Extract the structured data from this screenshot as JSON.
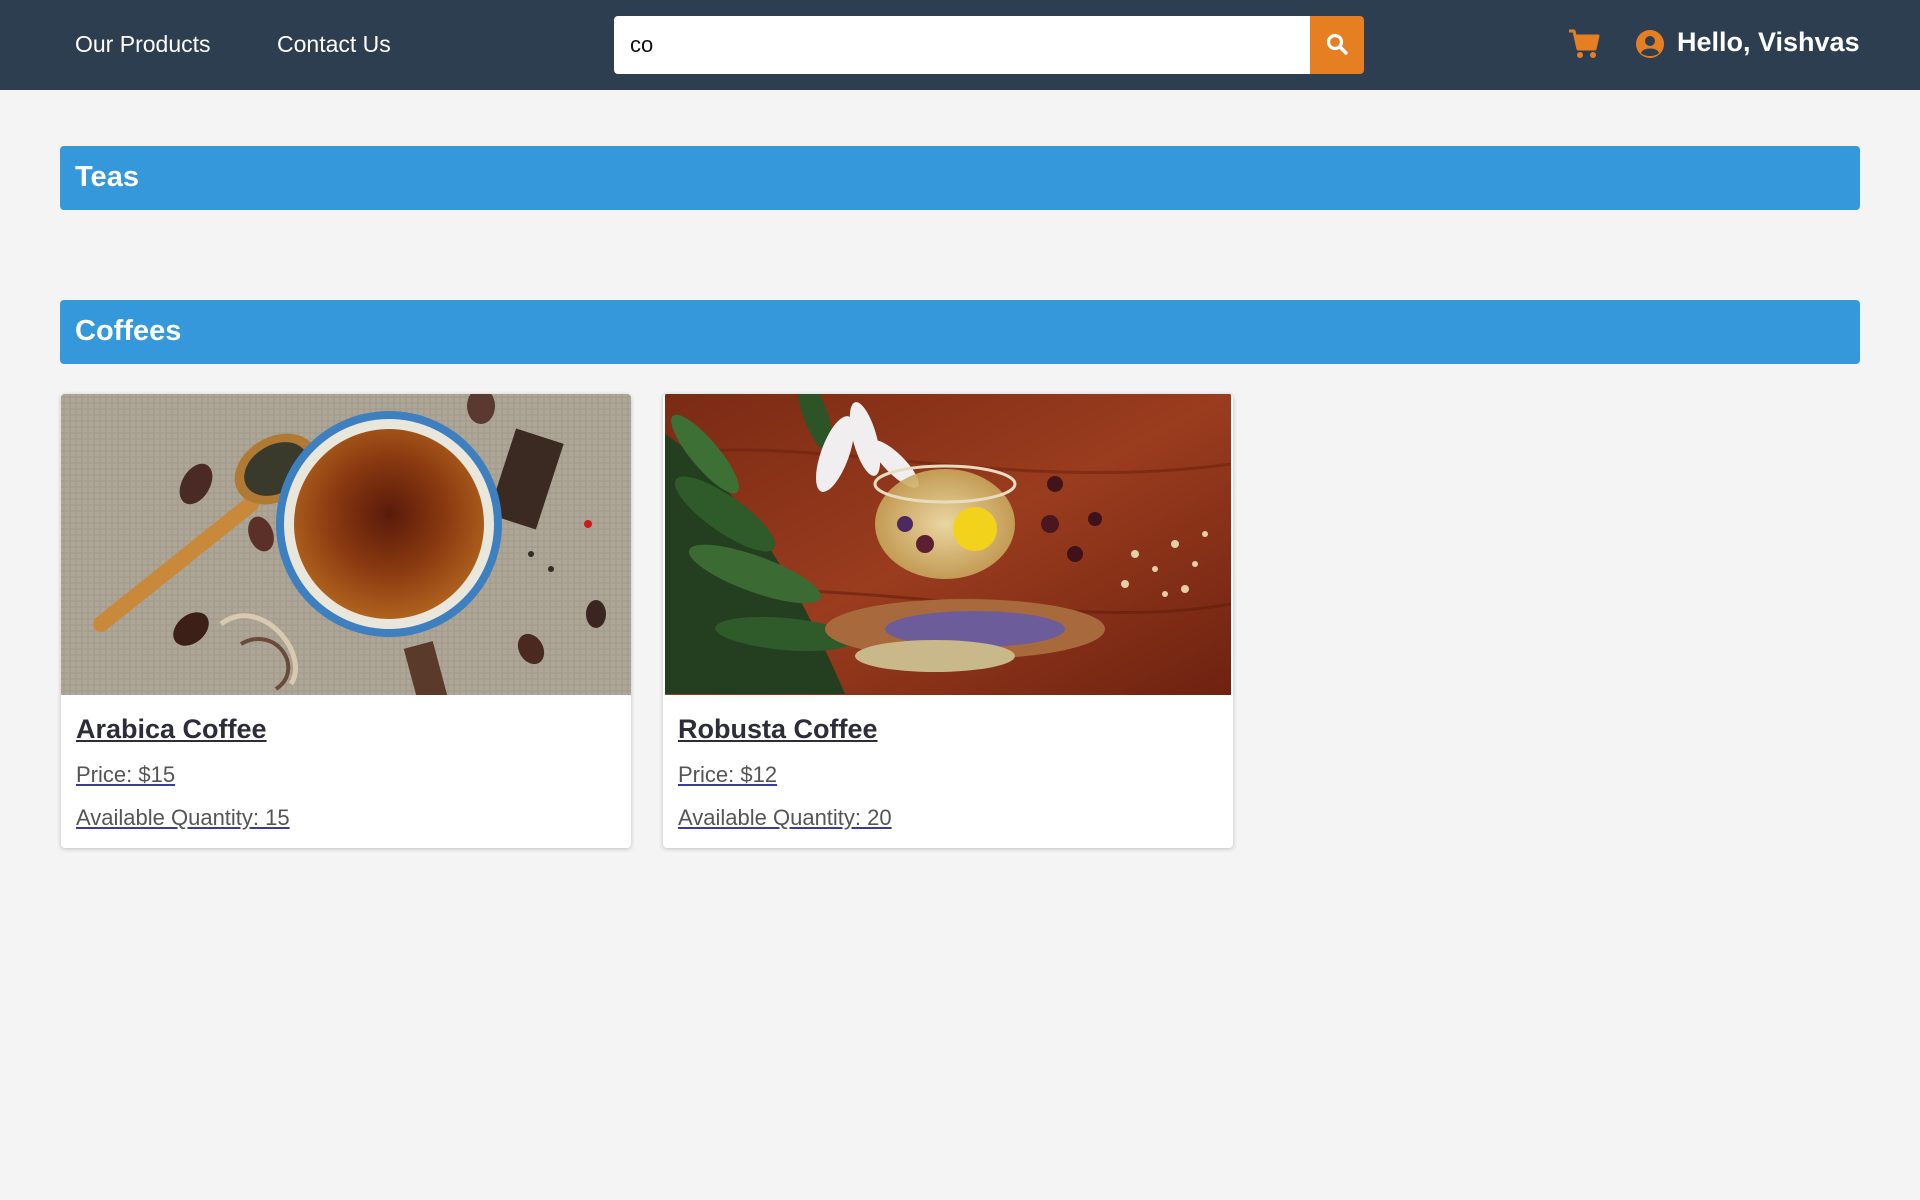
{
  "header": {
    "nav": [
      {
        "label": "Our Products"
      },
      {
        "label": "Contact Us"
      }
    ],
    "search": {
      "value": "co",
      "placeholder": ""
    },
    "greeting": "Hello, Vishvas"
  },
  "icons": {
    "search": "search-icon",
    "cart": "cart-icon",
    "user": "user-circle-icon"
  },
  "colors": {
    "header_bg": "#2c3e50",
    "accent": "#e67e22",
    "section_bar": "#3498db",
    "page_bg": "#f4f4f4"
  },
  "sections": [
    {
      "title": "Teas",
      "products": []
    },
    {
      "title": "Coffees",
      "products": [
        {
          "name": "Arabica Coffee",
          "price": "Price: $15",
          "quantity": "Available Quantity: 15",
          "image": "cup of tea with spices on burlap"
        },
        {
          "name": "Robusta Coffee",
          "price": "Price: $12",
          "quantity": "Available Quantity: 20",
          "image": "glass cup with herbs and fern on wooden table"
        }
      ]
    }
  ]
}
